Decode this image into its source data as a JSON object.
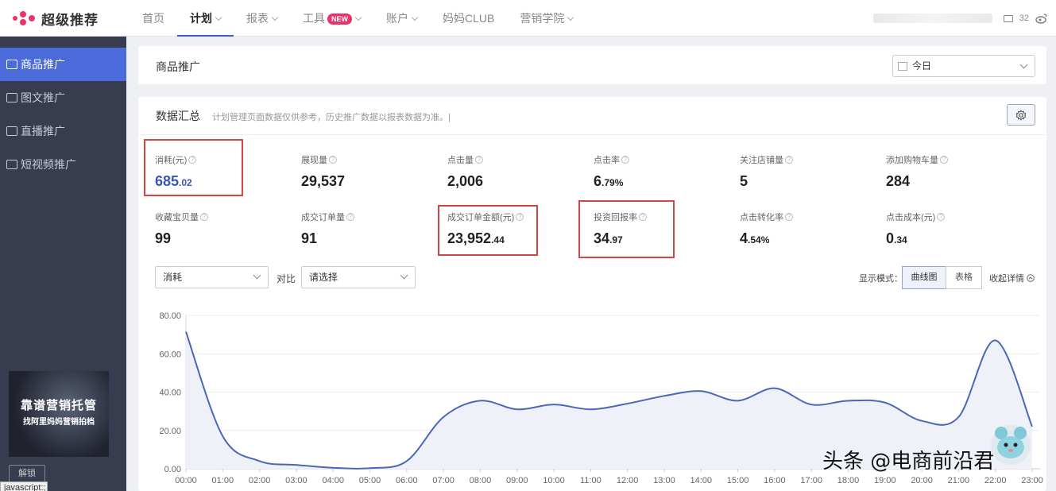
{
  "app": {
    "logo_text": "超级推荐",
    "brand_color": "#e8336b",
    "accent": "#4b6bdb"
  },
  "nav": {
    "items": [
      {
        "label": "首页",
        "dropdown": false,
        "active": false
      },
      {
        "label": "计划",
        "dropdown": true,
        "active": true
      },
      {
        "label": "报表",
        "dropdown": true,
        "active": false
      },
      {
        "label": "工具",
        "dropdown": true,
        "active": false,
        "badge": "NEW"
      },
      {
        "label": "账户",
        "dropdown": true,
        "active": false
      },
      {
        "label": "妈妈CLUB",
        "dropdown": false,
        "active": false
      },
      {
        "label": "营销学院",
        "dropdown": true,
        "active": false
      }
    ],
    "message_count": "32"
  },
  "sidebar": {
    "items": [
      {
        "label": "商品推广",
        "icon": "bag-icon",
        "active": true
      },
      {
        "label": "图文推广",
        "icon": "image-icon",
        "active": false
      },
      {
        "label": "直播推广",
        "icon": "live-icon",
        "active": false
      },
      {
        "label": "短视频推广",
        "icon": "video-icon",
        "active": false
      }
    ],
    "promo_line1": "靠谱营销托管",
    "promo_line2": "找阿里妈妈营销拍档",
    "unlock_label": "解锁",
    "status_text": "javascript:;"
  },
  "header_card": {
    "title": "商品推广",
    "date_value": "今日"
  },
  "summary": {
    "title": "数据汇总",
    "note": "计划管理页面数据仅供参考，历史推广数据以报表数据为准。|",
    "metrics": [
      {
        "label": "消耗(元)",
        "int": "685",
        "dec": ".02",
        "highlight": true
      },
      {
        "label": "展现量",
        "int": "29,537",
        "dec": ""
      },
      {
        "label": "点击量",
        "int": "2,006",
        "dec": ""
      },
      {
        "label": "点击率",
        "int": "6",
        "dec": ".79%"
      },
      {
        "label": "关注店铺量",
        "int": "5",
        "dec": ""
      },
      {
        "label": "添加购物车量",
        "int": "284",
        "dec": ""
      },
      {
        "label": "收藏宝贝量",
        "int": "99",
        "dec": ""
      },
      {
        "label": "成交订单量",
        "int": "91",
        "dec": ""
      },
      {
        "label": "成交订单金额(元)",
        "int": "23,952",
        "dec": ".44",
        "boxed": true
      },
      {
        "label": "投资回报率",
        "int": "34",
        "dec": ".97",
        "boxed": true
      },
      {
        "label": "点击转化率",
        "int": "4",
        "dec": ".54%"
      },
      {
        "label": "点击成本(元)",
        "int": "0",
        "dec": ".34"
      }
    ]
  },
  "controls": {
    "metric_select": "消耗",
    "compare_label": "对比",
    "compare_select": "请选择",
    "mode_label": "显示模式：",
    "mode_curve": "曲线图",
    "mode_table": "表格",
    "collapse_label": "收起详情"
  },
  "chart_data": {
    "type": "area",
    "x": [
      "00:00",
      "01:00",
      "02:00",
      "03:00",
      "04:00",
      "05:00",
      "06:00",
      "07:00",
      "08:00",
      "09:00",
      "10:00",
      "11:00",
      "12:00",
      "13:00",
      "14:00",
      "15:00",
      "16:00",
      "17:00",
      "18:00",
      "19:00",
      "20:00",
      "21:00",
      "22:00",
      "23:00"
    ],
    "series": [
      {
        "values": [
          71.5,
          17,
          4,
          2,
          0.5,
          0.3,
          4,
          27,
          35.5,
          31,
          33.5,
          31,
          34,
          38,
          40.5,
          35.5,
          42,
          33.5,
          35.5,
          34.5,
          25,
          27,
          67,
          22
        ]
      }
    ],
    "yticks": [
      "0.00",
      "20.00",
      "40.00",
      "60.00",
      "80.00"
    ],
    "ylim": [
      0,
      80
    ],
    "grid": true,
    "line_color": "#4a67b8",
    "fill_color": "#eef1f8"
  },
  "watermark": "头条 @电商前沿君"
}
